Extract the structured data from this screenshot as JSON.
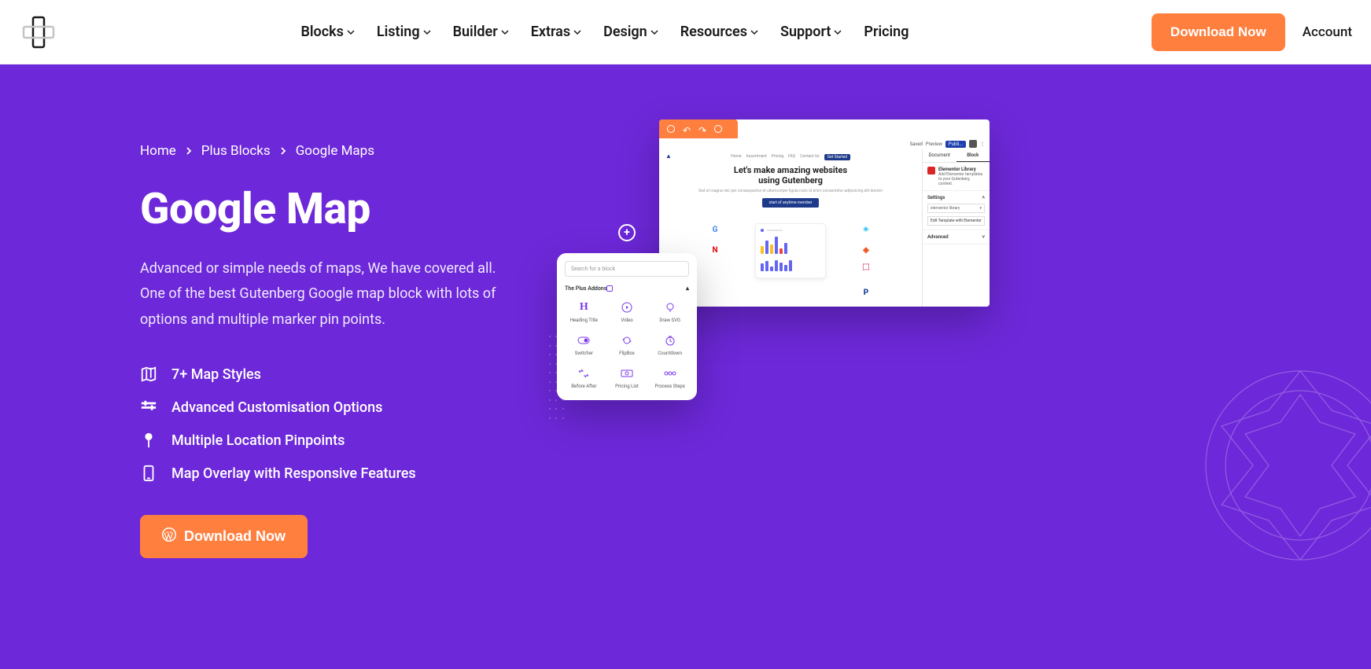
{
  "header": {
    "nav_items": [
      "Blocks",
      "Listing",
      "Builder",
      "Extras",
      "Design",
      "Resources",
      "Support"
    ],
    "pricing_label": "Pricing",
    "download_label": "Download Now",
    "account_label": "Account"
  },
  "breadcrumb": {
    "items": [
      "Home",
      "Plus Blocks",
      "Google Maps"
    ]
  },
  "hero": {
    "title": "Google Map",
    "description": "Advanced or simple needs of maps, We have covered all. One of the best Gutenberg Google map block with lots of options and multiple marker pin points.",
    "features": [
      {
        "icon": "map",
        "label": "7+ Map Styles"
      },
      {
        "icon": "sliders",
        "label": "Advanced Customisation Options"
      },
      {
        "icon": "pin",
        "label": "Multiple Location Pinpoints"
      },
      {
        "icon": "mobile",
        "label": "Map Overlay with Responsive Features"
      }
    ],
    "cta_label": "Download Now"
  },
  "mock": {
    "topbar": {
      "saved": "Saved",
      "preview": "Preview",
      "publish": "Publi..."
    },
    "content": {
      "nav": [
        "Home",
        "Assortment",
        "Pricing",
        "FAQ",
        "Contact Us"
      ],
      "started": "Get Started",
      "headline1": "Let's make amazing websites",
      "headline2": "using Gutenberg",
      "subtext": "Sed ut magna nec per consequuntur et ullamcorper ligula nunc id enim consectetur adipisicing elit leorem",
      "btn": "start of anytime member"
    },
    "sidebar": {
      "tab_document": "Document",
      "tab_block": "Block",
      "lib_title": "Elementor Library",
      "lib_desc": "Add Elementor templates to your Gutenberg content.",
      "settings": "Settings",
      "input_label": "elementor library",
      "edit_btn": "Edit Template with Elementor",
      "advanced": "Advanced"
    }
  },
  "block_panel": {
    "search_placeholder": "Search for a block",
    "header": "The Plus Addons",
    "items": [
      {
        "icon": "H",
        "label": "Heading Title"
      },
      {
        "icon": "play",
        "label": "Video"
      },
      {
        "icon": "bulb",
        "label": "Draw SVG"
      },
      {
        "icon": "toggle",
        "label": "Switcher"
      },
      {
        "icon": "flip",
        "label": "FlipBox"
      },
      {
        "icon": "timer",
        "label": "Countdown"
      },
      {
        "icon": "compare",
        "label": "Before After"
      },
      {
        "icon": "price",
        "label": "Pricing List"
      },
      {
        "icon": "steps",
        "label": "Process Steps"
      }
    ]
  }
}
